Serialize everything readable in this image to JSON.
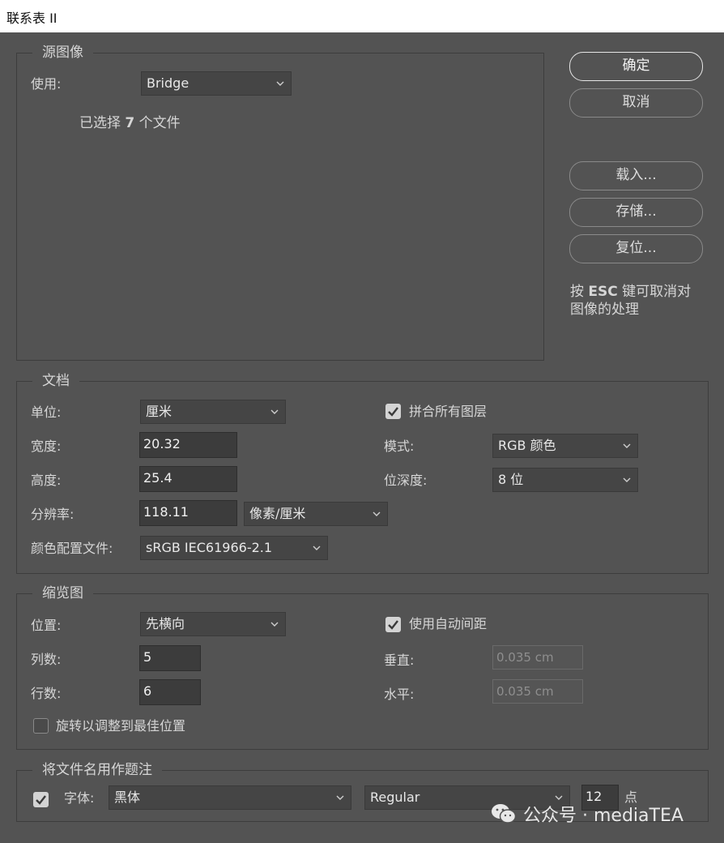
{
  "window": {
    "title": "联系表 II"
  },
  "source": {
    "legend": "源图像",
    "use_label": "使用:",
    "use_value": "Bridge",
    "selection_prefix": "已选择",
    "selection_count": "7",
    "selection_suffix": "个文件"
  },
  "buttons": {
    "ok": "确定",
    "cancel": "取消",
    "load": "载入...",
    "save": "存储...",
    "reset": "复位...",
    "hint_line1_a": "按",
    "hint_key": "ESC",
    "hint_line1_b": "键可取消对",
    "hint_line2": "图像的处理"
  },
  "document": {
    "legend": "文档",
    "units_label": "单位:",
    "units_value": "厘米",
    "width_label": "宽度:",
    "width_value": "20.32",
    "height_label": "高度:",
    "height_value": "25.4",
    "resolution_label": "分辨率:",
    "resolution_value": "118.11",
    "resolution_unit": "像素/厘米",
    "profile_label": "颜色配置文件:",
    "profile_value": "sRGB IEC61966-2.1",
    "flatten_label": "拼合所有图层",
    "flatten_checked": true,
    "mode_label": "模式:",
    "mode_value": "RGB 颜色",
    "depth_label": "位深度:",
    "depth_value": "8 位"
  },
  "thumbnails": {
    "legend": "缩览图",
    "place_label": "位置:",
    "place_value": "先横向",
    "columns_label": "列数:",
    "columns_value": "5",
    "rows_label": "行数:",
    "rows_value": "6",
    "rotate_label": "旋转以调整到最佳位置",
    "rotate_checked": false,
    "auto_spacing_label": "使用自动间距",
    "auto_spacing_checked": true,
    "vertical_label": "垂直:",
    "vertical_value": "0.035 cm",
    "horizontal_label": "水平:",
    "horizontal_value": "0.035 cm"
  },
  "caption": {
    "legend": "将文件名用作题注",
    "enabled": true,
    "font_label": "字体:",
    "font_value": "黑体",
    "style_value": "Regular",
    "size_value": "12",
    "size_unit": "点"
  },
  "watermark": {
    "text": "公众号 · mediaTEA"
  },
  "icons": {
    "chevron": "chevron-down-icon",
    "check": "checkmark-icon",
    "wechat": "wechat-icon"
  }
}
